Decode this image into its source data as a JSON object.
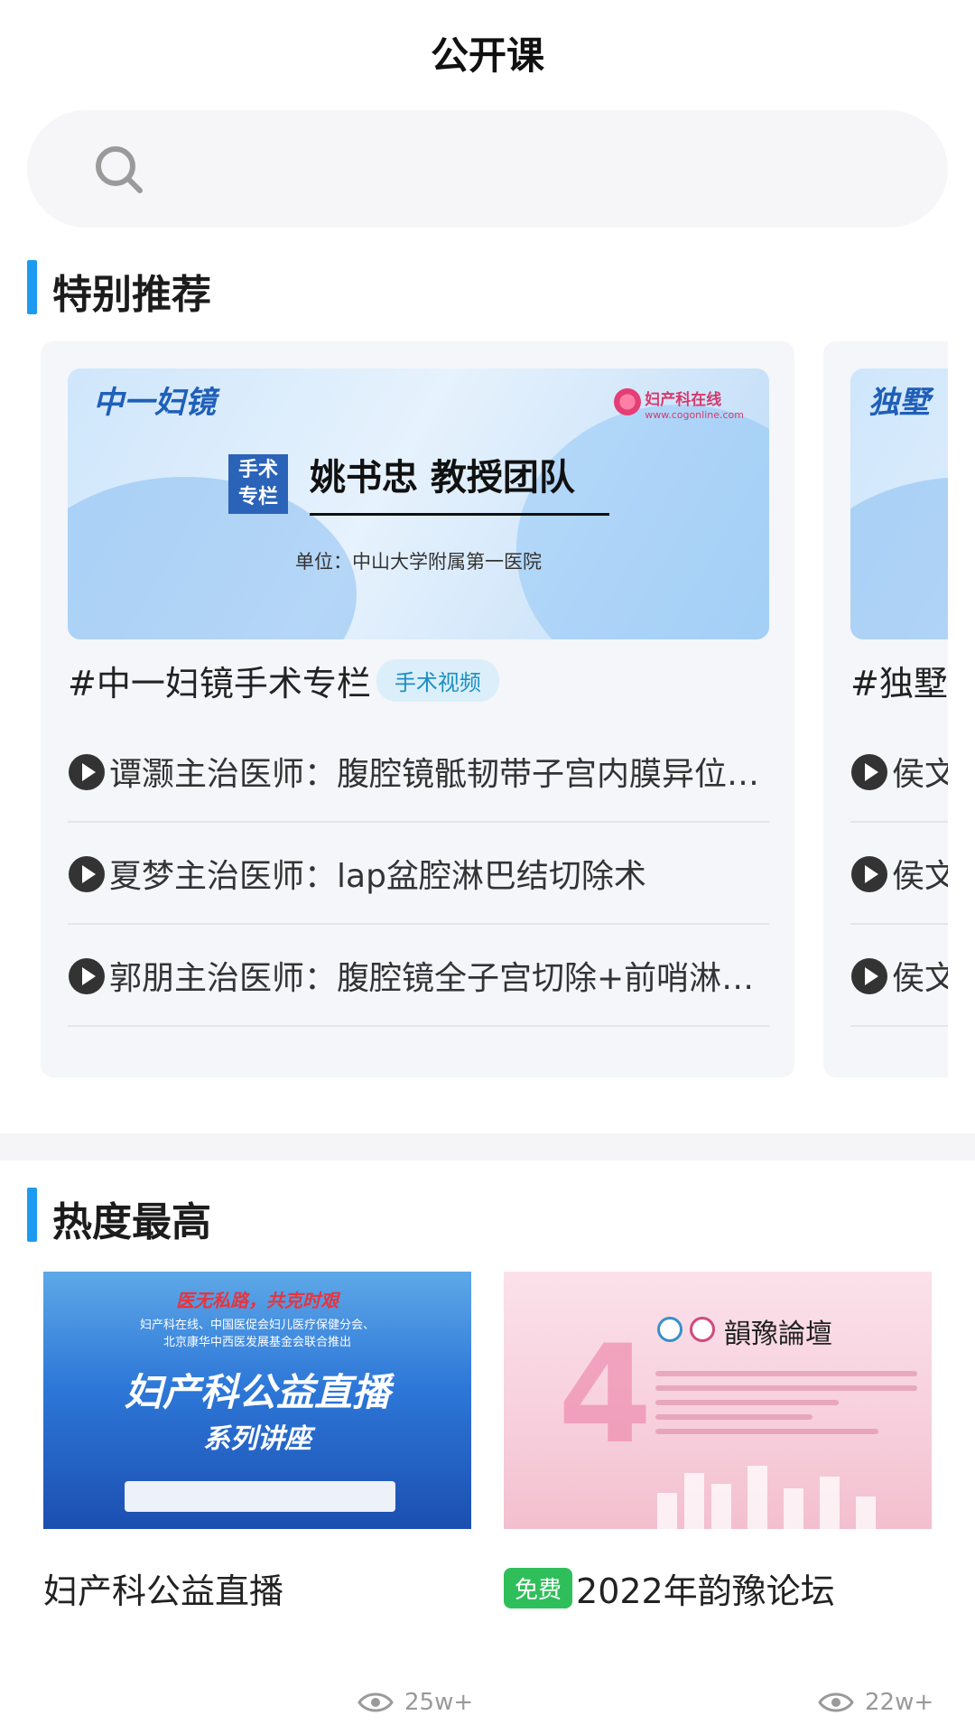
{
  "header": {
    "title": "公开课"
  },
  "search": {
    "placeholder": ""
  },
  "sections": {
    "recommend": "特别推荐",
    "hot": "热度最高"
  },
  "recommend_cards": [
    {
      "banner_series": "中一妇镜",
      "banner_brand": "妇产科在线",
      "banner_url": "www.cogonline.com",
      "banner_tag": "手术专栏",
      "banner_tag_line1": "手术",
      "banner_tag_line2": "专栏",
      "banner_name": "姚书忠 教授团队",
      "banner_unit": "单位：中山大学附属第一医院",
      "title": "#中一妇镜手术专栏",
      "tag": "手术视频",
      "items": [
        "谭灏主治医师：腹腔镜骶韧带子宫内膜异位病灶切除术",
        "夏梦主治医师：lap盆腔淋巴结切除术",
        "郭朋主治医师：腹腔镜全子宫切除+前哨淋巴结活检"
      ]
    },
    {
      "banner_series": "独墅",
      "title": "#独墅",
      "items": [
        "侯文",
        "侯文",
        "侯文"
      ]
    }
  ],
  "hot_cards": [
    {
      "slogan": "医无私路，共克时艰",
      "sub_line1": "妇产科在线、中国医促会妇儿医疗保健分会、",
      "sub_line2": "北京康华中西医发展基金会联合推出",
      "big": "妇产科公益直播",
      "mid": "系列讲座",
      "title": "妇产科公益直播",
      "views": "25w+"
    },
    {
      "forum": "韻豫論壇",
      "free_badge": "免费",
      "title": "2022年韵豫论坛",
      "views": "22w+"
    }
  ],
  "colors": {
    "accent": "#1e9bf0",
    "free": "#2fbf5a",
    "tag_bg": "#dbeffa"
  }
}
